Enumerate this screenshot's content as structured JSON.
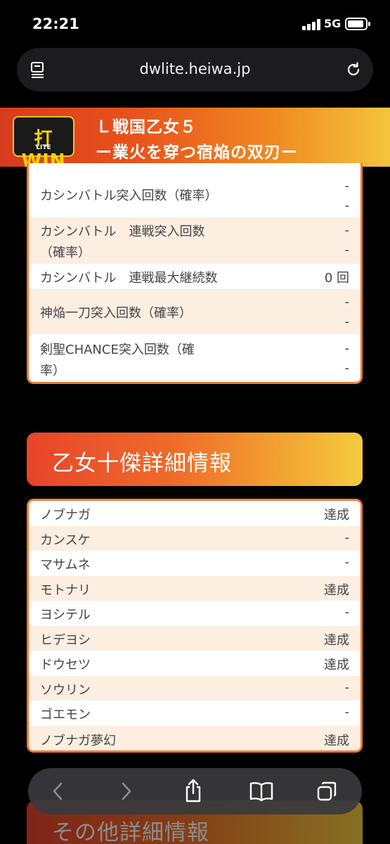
{
  "status_bar": {
    "time": "22:21",
    "network": "5G"
  },
  "browser": {
    "url": "dwlite.heiwa.jp"
  },
  "game": {
    "logo_text": "打WIN",
    "logo_sub": "LITE",
    "title_line1": "Ｌ戦国乙女５",
    "title_line2": "ー業火を穿つ宿焔の双刃ー"
  },
  "stats": [
    {
      "label": "カシンバトル突入回数（確率）",
      "value_line1": "-",
      "value_line2": "-"
    },
    {
      "label_line1": "カシンバトル　連戦突入回数",
      "label_line2": "（確率）",
      "value_line1": "-",
      "value_line2": "-"
    },
    {
      "label": "カシンバトル　連戦最大継続数",
      "value": "0 回"
    },
    {
      "label": "神焔一刀突入回数（確率）",
      "value_line1": "-",
      "value_line2": "-"
    },
    {
      "label_line1": "剣聖CHANCE突入回数（確",
      "label_line2": "率）",
      "value_line1": "-",
      "value_line2": "-"
    }
  ],
  "section_otome": {
    "heading": "乙女十傑詳細情報"
  },
  "otome_list": [
    {
      "name": "ノブナガ",
      "status": "達成"
    },
    {
      "name": "カンスケ",
      "status": "-"
    },
    {
      "name": "マサムネ",
      "status": "-"
    },
    {
      "name": "モトナリ",
      "status": "達成"
    },
    {
      "name": "ヨシテル",
      "status": "-"
    },
    {
      "name": "ヒデヨシ",
      "status": "達成"
    },
    {
      "name": "ドウセツ",
      "status": "達成"
    },
    {
      "name": "ソウリン",
      "status": "-"
    },
    {
      "name": "ゴエモン",
      "status": "-"
    },
    {
      "name": "ノブナガ夢幻",
      "status": "達成"
    }
  ],
  "section_other": {
    "heading": "その他詳細情報"
  },
  "toolbar": {
    "icons": [
      "back-icon",
      "forward-icon",
      "share-icon",
      "bookmarks-icon",
      "tabs-icon"
    ]
  }
}
